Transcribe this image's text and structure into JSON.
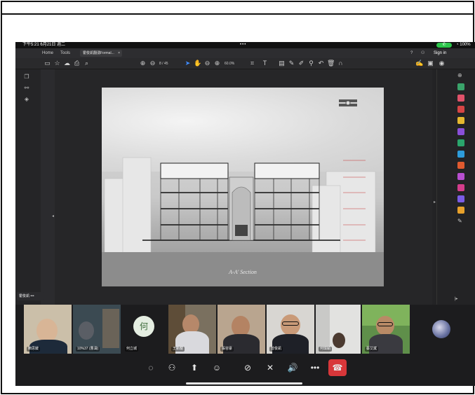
{
  "status": {
    "time": "下午5:21",
    "date": "6月21日 週二",
    "dots": "•••",
    "battery": "100%"
  },
  "pdf": {
    "nav": [
      "Home",
      "Tools"
    ],
    "tab_title": "霍俊凱翻湧Formal...",
    "sign_in": "Sign in",
    "page_indicator": "8 / 45",
    "zoom": "60.0%"
  },
  "slide": {
    "caption": "A-A' Section"
  },
  "call": {
    "presenter_label": "霍俊凱"
  },
  "participants": [
    {
      "name": "賴思媛",
      "avatar": ""
    },
    {
      "name": "10%37 (曹濤)",
      "avatar": ""
    },
    {
      "name": "何立城",
      "avatar": "何"
    },
    {
      "name": "王新龍",
      "avatar": ""
    },
    {
      "name": "張容豪",
      "avatar": ""
    },
    {
      "name": "曾俊凱",
      "avatar": ""
    },
    {
      "name": "何琪穎",
      "avatar": ""
    },
    {
      "name": "蔡艾斌",
      "avatar": ""
    }
  ],
  "colors": {
    "end_call": "#d8373a",
    "accent": "#3f8cff",
    "call_pill": "#2bc54a"
  }
}
